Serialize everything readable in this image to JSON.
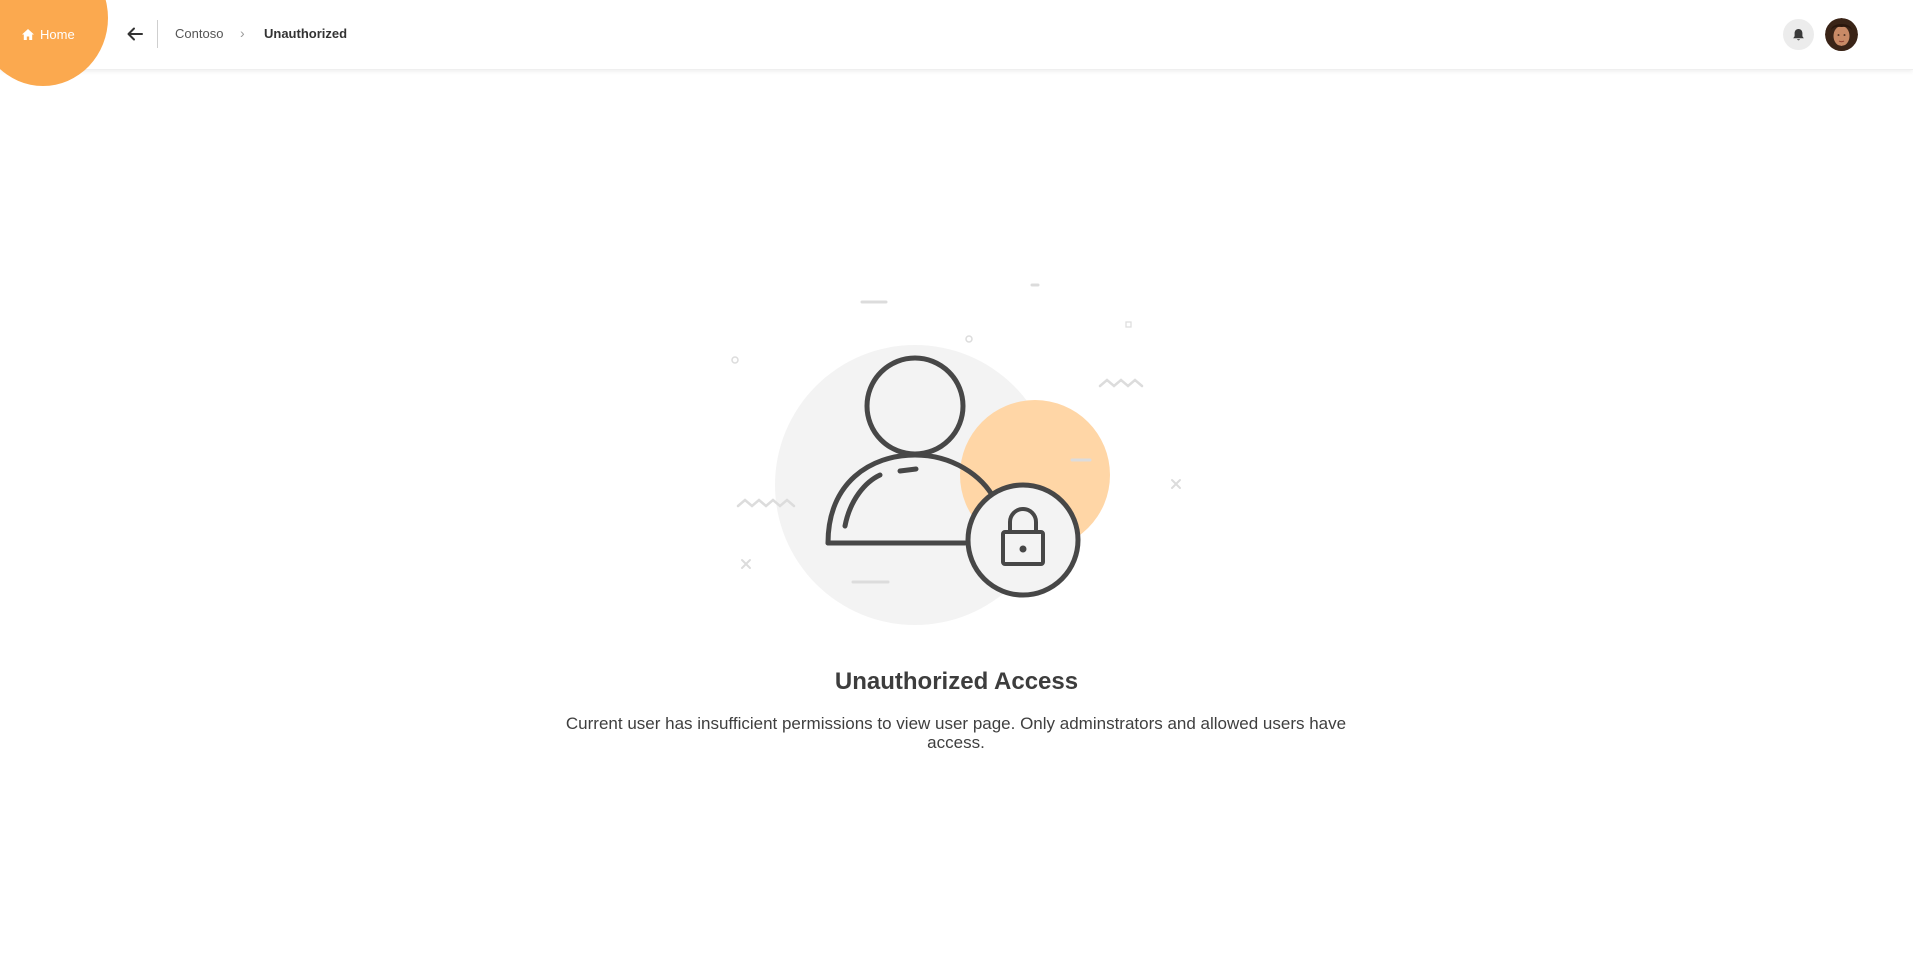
{
  "header": {
    "home_label": "Home",
    "breadcrumb": {
      "parent": "Contoso",
      "separator": "›",
      "current": "Unauthorized"
    }
  },
  "main": {
    "title": "Unauthorized Access",
    "description": "Current user has insufficient permissions to view user page. Only adminstrators and allowed users have access."
  },
  "icons": {
    "home": "home-icon",
    "back": "arrow-left-icon",
    "notifications": "bell-icon",
    "avatar": "user-avatar",
    "illustration": "user-lock-illustration"
  },
  "colors": {
    "accent": "#fba94f",
    "accent_light": "#ffd6a6",
    "illustration_gray": "#f3f3f3",
    "stroke": "#474747"
  }
}
